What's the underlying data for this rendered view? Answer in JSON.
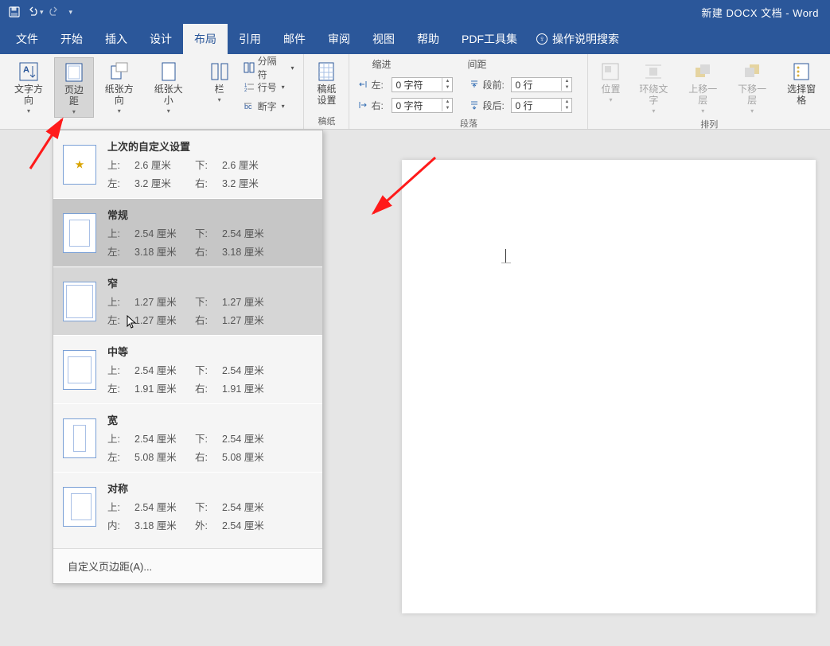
{
  "app_title": "新建 DOCX 文档 - Word",
  "tabs": {
    "file": "文件",
    "home": "开始",
    "insert": "插入",
    "design": "设计",
    "layout": "布局",
    "references": "引用",
    "mailings": "邮件",
    "review": "审阅",
    "view": "视图",
    "help": "帮助",
    "pdf": "PDF工具集",
    "tell_me": "操作说明搜索"
  },
  "ribbon": {
    "text_direction": "文字方向",
    "margins": "页边距",
    "orientation": "纸张方向",
    "size": "纸张大小",
    "columns": "栏",
    "breaks": "分隔符",
    "line_numbers": "行号",
    "hyphenation": "断字",
    "draft_paper": "稿纸\n设置",
    "draft_group": "稿纸",
    "indent_heading": "缩进",
    "spacing_heading": "间距",
    "indent_left_label": "左:",
    "indent_right_label": "右:",
    "spacing_before_label": "段前:",
    "spacing_after_label": "段后:",
    "indent_left_value": "0 字符",
    "indent_right_value": "0 字符",
    "spacing_before_value": "0 行",
    "spacing_after_value": "0 行",
    "paragraph_group": "段落",
    "position": "位置",
    "wrap_text": "环绕文字",
    "bring_forward": "上移一层",
    "send_backward": "下移一层",
    "selection_pane": "选择窗格",
    "arrange_group": "排列"
  },
  "margins_menu": {
    "items": [
      {
        "title": "上次的自定义设置",
        "top_l": "上:",
        "top": "2.6 厘米",
        "bottom_l": "下:",
        "bottom": "2.6 厘米",
        "left_l": "左:",
        "left": "3.2 厘米",
        "right_l": "右:",
        "right": "3.2 厘米",
        "star": true
      },
      {
        "title": "常规",
        "top_l": "上:",
        "top": "2.54 厘米",
        "bottom_l": "下:",
        "bottom": "2.54 厘米",
        "left_l": "左:",
        "left": "3.18 厘米",
        "right_l": "右:",
        "right": "3.18 厘米"
      },
      {
        "title": "窄",
        "top_l": "上:",
        "top": "1.27 厘米",
        "bottom_l": "下:",
        "bottom": "1.27 厘米",
        "left_l": "左:",
        "left": "1.27 厘米",
        "right_l": "右:",
        "right": "1.27 厘米"
      },
      {
        "title": "中等",
        "top_l": "上:",
        "top": "2.54 厘米",
        "bottom_l": "下:",
        "bottom": "2.54 厘米",
        "left_l": "左:",
        "left": "1.91 厘米",
        "right_l": "右:",
        "right": "1.91 厘米"
      },
      {
        "title": "宽",
        "top_l": "上:",
        "top": "2.54 厘米",
        "bottom_l": "下:",
        "bottom": "2.54 厘米",
        "left_l": "左:",
        "left": "5.08 厘米",
        "right_l": "右:",
        "right": "5.08 厘米"
      },
      {
        "title": "对称",
        "top_l": "上:",
        "top": "2.54 厘米",
        "bottom_l": "下:",
        "bottom": "2.54 厘米",
        "left_l": "内:",
        "left": "3.18 厘米",
        "right_l": "外:",
        "right": "2.54 厘米"
      }
    ],
    "custom": "自定义页边距(A)..."
  }
}
